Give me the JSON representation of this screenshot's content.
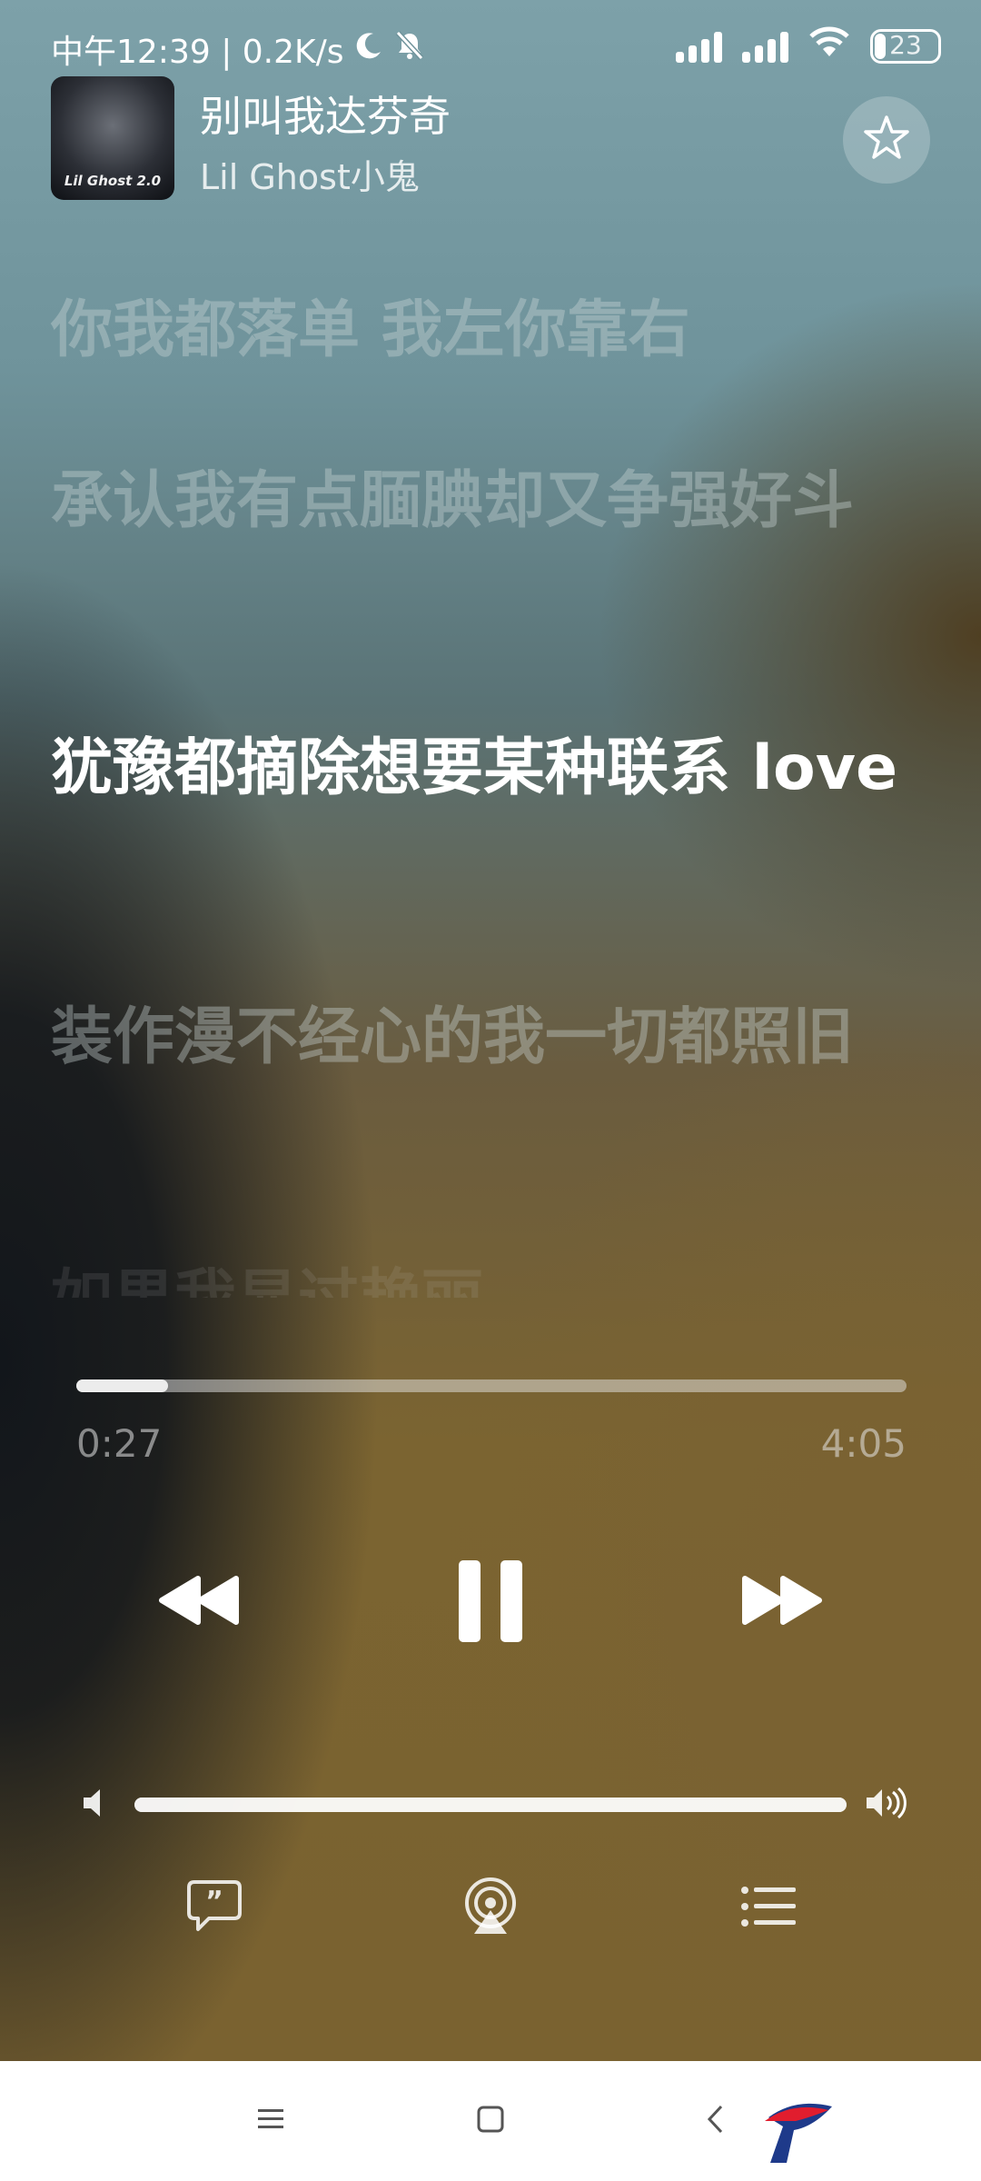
{
  "status_bar": {
    "left_text": "中午12:39 | 0.2K/s",
    "battery": "23"
  },
  "now_playing": {
    "title": "别叫我达芬奇",
    "artist": "Lil Ghost小鬼",
    "album_art_text": "Lil Ghost 2.0"
  },
  "lyrics": [
    "你我都落单 我左你靠右",
    "承认我有点腼腆却又争强好斗",
    "犹豫都摘除想要某种联系 love",
    "装作漫不经心的我一切都照旧",
    "如果我显过艳丽"
  ],
  "playback": {
    "elapsed": "0:27",
    "duration": "4:05",
    "progress": 0.11
  },
  "volume": {
    "level": 1.0
  },
  "icons": {
    "moon": "moon-icon",
    "mute": "bell-off-icon",
    "signal": "signal-icon",
    "wifi": "wifi-icon",
    "battery": "battery-icon",
    "favorite": "star-icon",
    "rewind": "rewind-icon",
    "pause": "pause-icon",
    "forward": "fast-forward-icon",
    "volume_low": "speaker-low-icon",
    "volume_high": "speaker-high-icon",
    "lyrics": "lyrics-quote-icon",
    "airplay": "airplay-icon",
    "queue": "queue-list-icon",
    "nav_menu": "menu-icon",
    "nav_home": "home-square-icon",
    "nav_back": "back-chevron-icon"
  },
  "colors": {
    "active_lyric": "#ffffff",
    "inactive_lyric": "#cdd7d7",
    "navbar": "#ffffff"
  }
}
